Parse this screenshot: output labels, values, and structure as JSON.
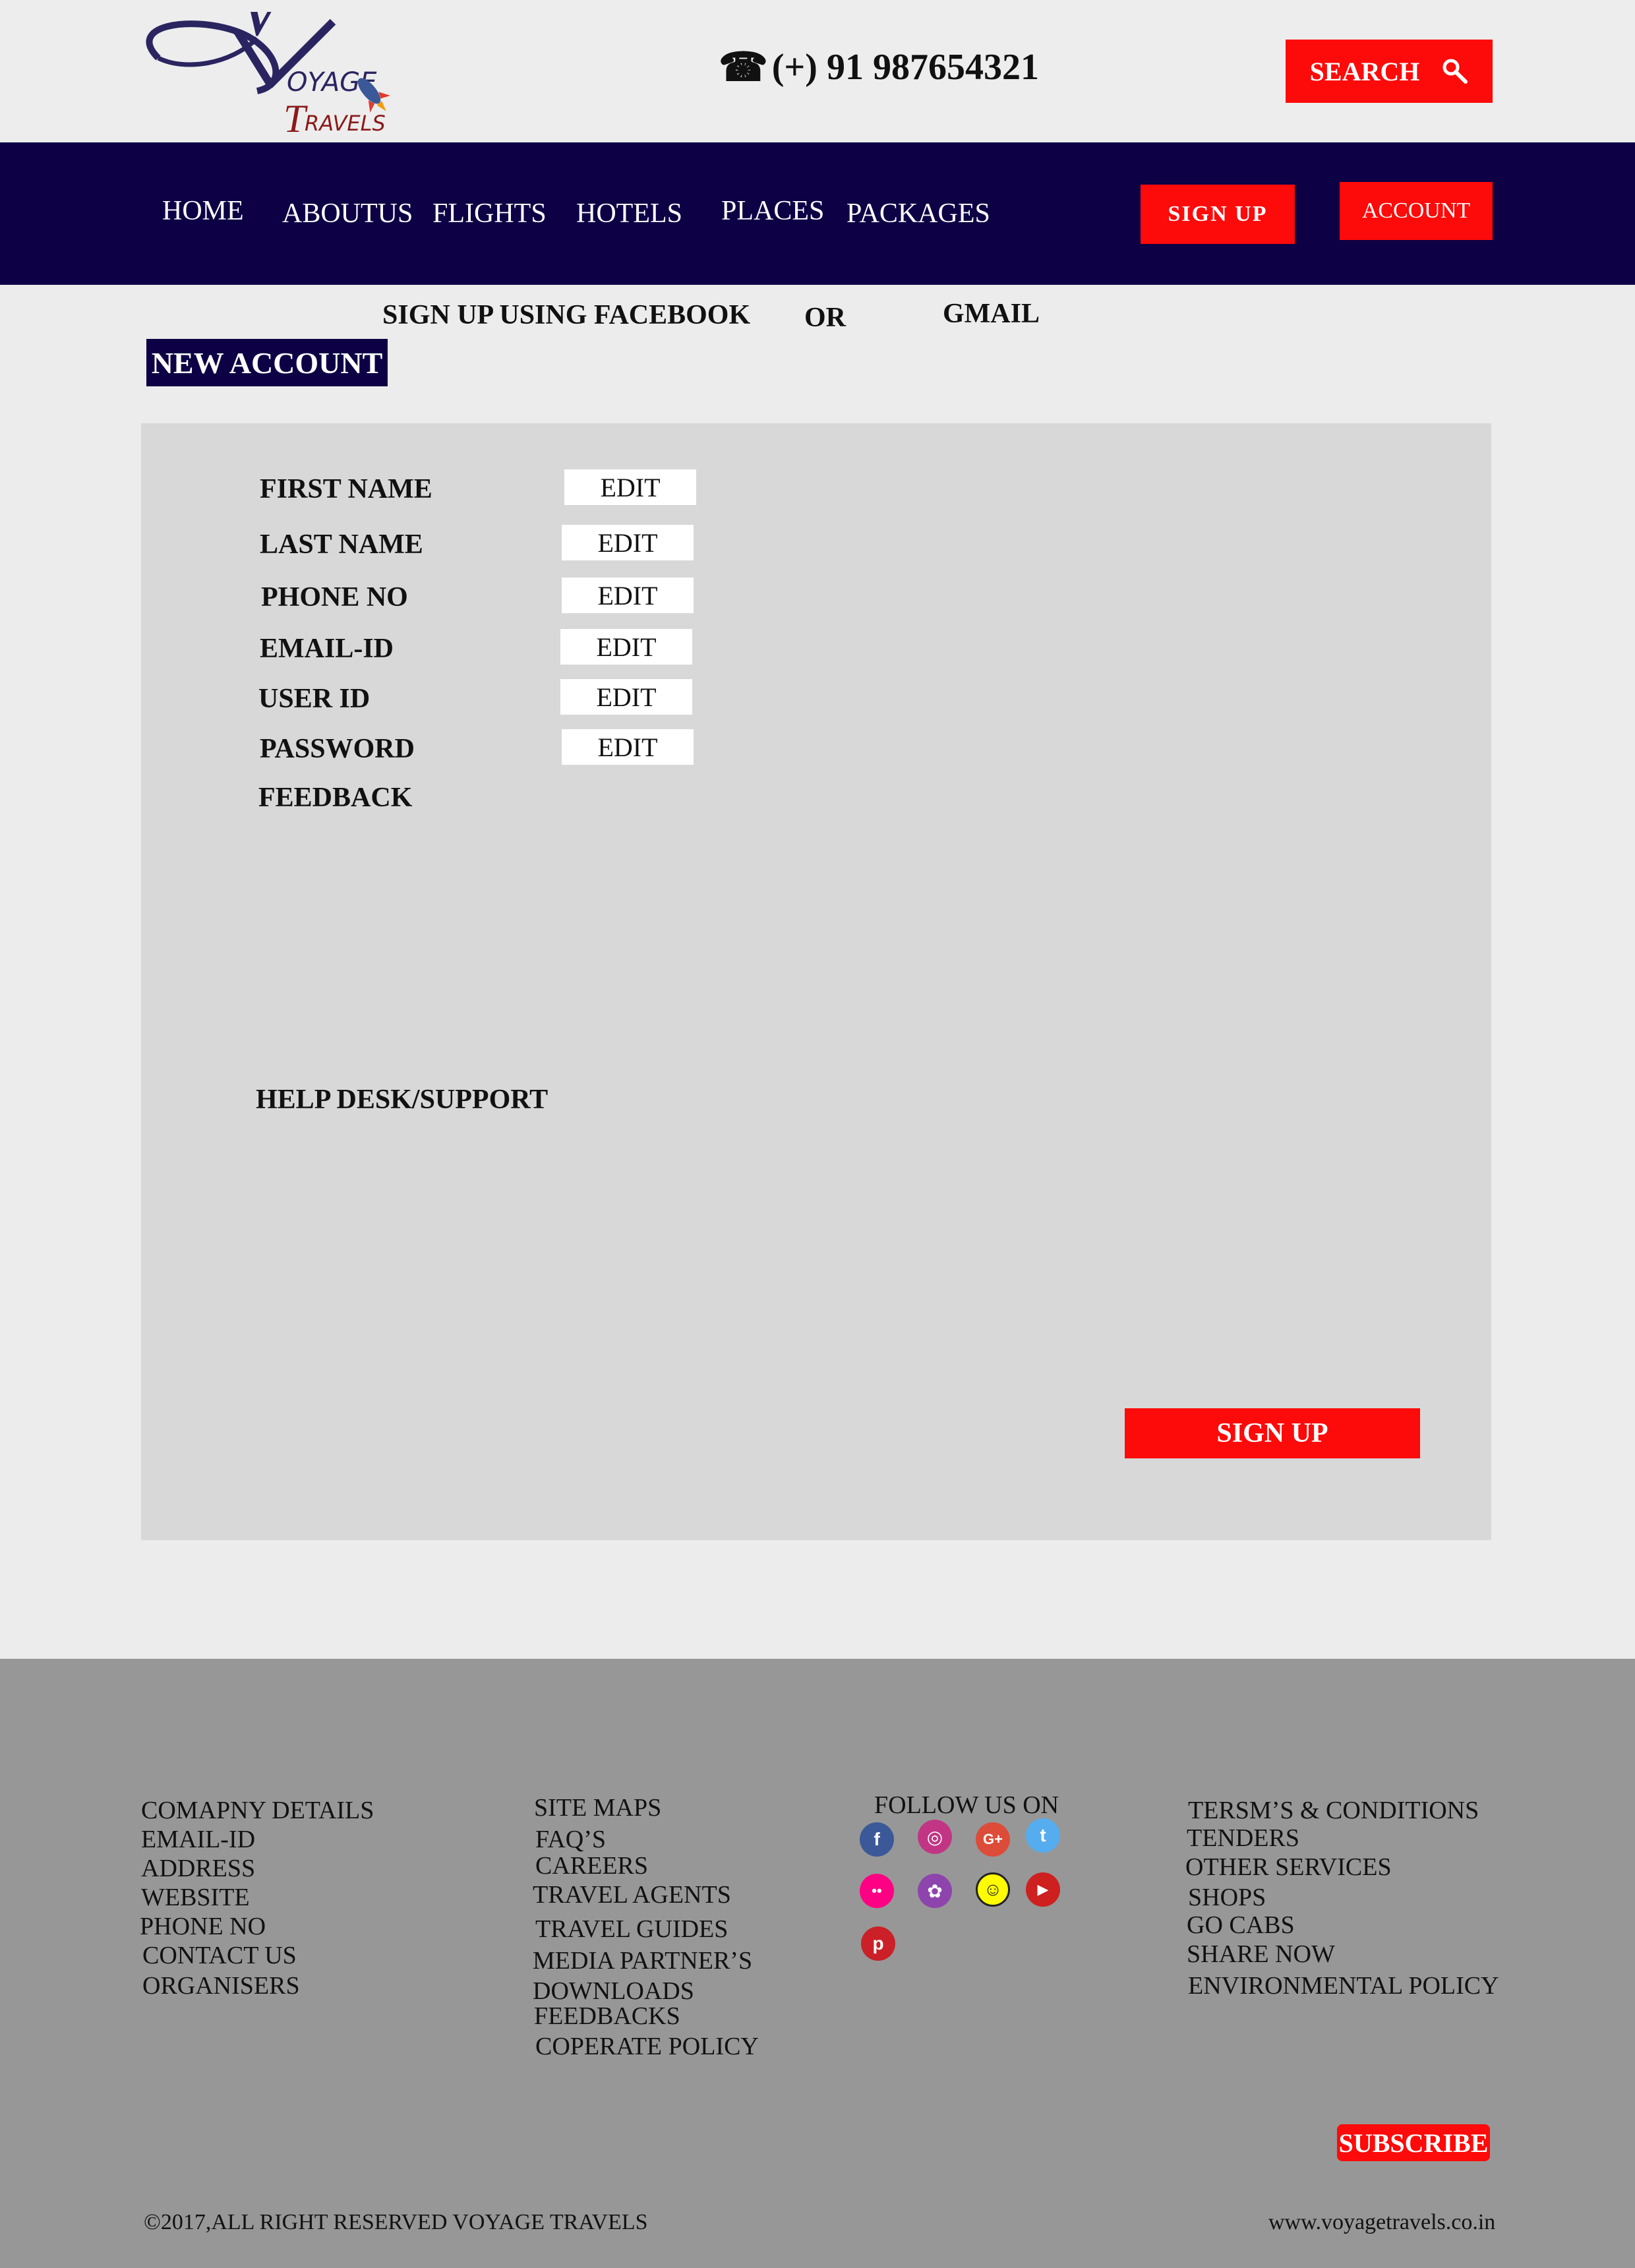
{
  "header": {
    "logo": {
      "word1": "OYAGE",
      "initial1": "V",
      "initial2": "T",
      "word2": "RAVELS"
    },
    "phone": "(+) 91 987654321",
    "phone_icon": "phone-icon",
    "search_label": "SEARCH",
    "search_icon": "search-icon"
  },
  "nav": {
    "items": [
      "HOME",
      "ABOUTUS",
      "FLIGHTS",
      "HOTELS",
      "PLACES",
      "PACKAGES"
    ],
    "signup_label": "SIGN UP",
    "account_label": "ACCOUNT"
  },
  "signup_options": {
    "facebook": "SIGN UP USING FACEBOOK",
    "or": "OR",
    "gmail": "GMAIL",
    "new_account": "NEW ACCOUNT"
  },
  "form": {
    "fields": [
      {
        "label": "FIRST NAME",
        "value": "EDIT"
      },
      {
        "label": "LAST NAME",
        "value": "EDIT"
      },
      {
        "label": "PHONE NO",
        "value": "EDIT"
      },
      {
        "label": "EMAIL-ID",
        "value": "EDIT"
      },
      {
        "label": "USER ID",
        "value": "EDIT"
      },
      {
        "label": "PASSWORD",
        "value": "EDIT"
      }
    ],
    "feedback_label": "FEEDBACK",
    "help_label": "HELP DESK/SUPPORT",
    "submit_label": "SIGN UP"
  },
  "footer": {
    "col1": [
      "COMAPNY DETAILS",
      "EMAIL-ID",
      "ADDRESS",
      "WEBSITE",
      "PHONE NO",
      "CONTACT US",
      "ORGANISERS"
    ],
    "col2": [
      "SITE MAPS",
      "FAQ’S",
      "CAREERS",
      "TRAVEL AGENTS",
      "TRAVEL GUIDES",
      "MEDIA PARTNER’S",
      "DOWNLOADS",
      "FEEDBACKS",
      "COPERATE POLICY"
    ],
    "follow_label": "FOLLOW US ON",
    "social": [
      {
        "name": "facebook-icon",
        "glyph": "f",
        "color": "#3b5998"
      },
      {
        "name": "instagram-icon",
        "glyph": "◎",
        "color": "#c13584"
      },
      {
        "name": "google-plus-icon",
        "glyph": "G+",
        "color": "#dd4b39"
      },
      {
        "name": "twitter-icon",
        "glyph": "t",
        "color": "#55acee"
      },
      {
        "name": "flickr-icon",
        "glyph": "••",
        "color": "#ff0084"
      },
      {
        "name": "picasa-icon",
        "glyph": "✿",
        "color": "#8e44ad"
      },
      {
        "name": "snapchat-icon",
        "glyph": "☺",
        "color": "#fffc00"
      },
      {
        "name": "youtube-icon",
        "glyph": "▶",
        "color": "#cd201f"
      },
      {
        "name": "pinterest-icon",
        "glyph": "p",
        "color": "#cb2027"
      }
    ],
    "col4": [
      "TERSM’S & CONDITIONS",
      "TENDERS",
      "OTHER SERVICES",
      "SHOPS",
      "GO CABS",
      "SHARE NOW",
      "ENVIRONMENTAL POLICY"
    ],
    "subscribe_label": "SUBSCRIBE",
    "copyright": "©2017,ALL RIGHT RESERVED VOYAGE TRAVELS",
    "url": "www.voyagetravels.co.in"
  },
  "colors": {
    "navy": "#0d0045",
    "red": "#fd0a0a",
    "page_bg": "#ececec",
    "panel_bg": "#d8d8d8",
    "footer_bg": "#979797"
  }
}
